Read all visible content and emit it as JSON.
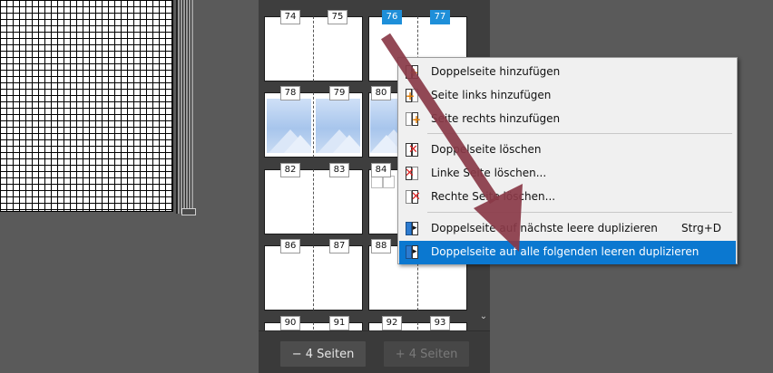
{
  "pages": {
    "row1": [
      "74",
      "75",
      "76",
      "77"
    ],
    "row2": [
      "78",
      "79",
      "80"
    ],
    "row3": [
      "82",
      "83",
      "84"
    ],
    "row4": [
      "86",
      "87",
      "88"
    ],
    "row5": [
      "90",
      "91",
      "92",
      "93"
    ]
  },
  "panel": {
    "remove_pages_label": "− 4 Seiten",
    "add_pages_label": "+ 4 Seiten"
  },
  "menu": {
    "items": [
      {
        "label": "Doppelseite hinzufügen",
        "icon": "add-spread-icon"
      },
      {
        "label": "Seite links hinzufügen",
        "icon": "add-left-page-icon"
      },
      {
        "label": "Seite rechts hinzufügen",
        "icon": "add-right-page-icon"
      },
      {
        "label": "Doppelseite löschen",
        "icon": "delete-spread-icon"
      },
      {
        "label": "Linke Seite löschen...",
        "icon": "delete-left-page-icon"
      },
      {
        "label": "Rechte Seite löschen...",
        "icon": "delete-right-page-icon"
      },
      {
        "label": "Doppelseite auf nächste leere duplizieren",
        "shortcut": "Strg+D",
        "icon": "duplicate-next-icon"
      },
      {
        "label": "Doppelseite auf alle folgenden leeren duplizieren",
        "icon": "duplicate-all-icon"
      }
    ]
  },
  "colors": {
    "selection": "#1e8fd9",
    "menu_highlight": "#0b78d0",
    "arrow": "#8a3a48"
  }
}
